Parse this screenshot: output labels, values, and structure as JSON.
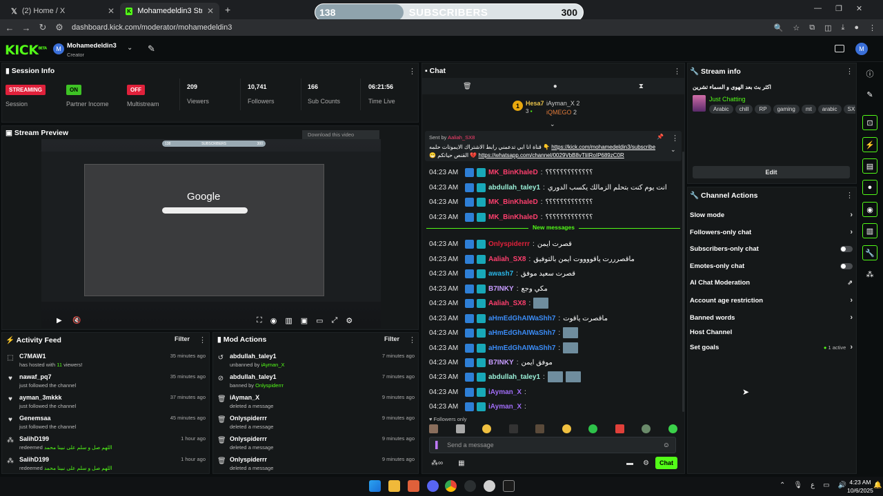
{
  "browser": {
    "tabs": [
      {
        "title": "(2) Home / X"
      },
      {
        "title": "Mohamedeldin3 Stream - Kick"
      }
    ],
    "url": "dashboard.kick.com/moderator/mohamedeldin3"
  },
  "overlay": {
    "left": "138",
    "label": "SUBSCRIBERS",
    "right": "300",
    "progress": 0.33
  },
  "header": {
    "logo": "KICK",
    "channel": "Mohamedeldin3",
    "role": "Creator",
    "avatar": "M"
  },
  "session": {
    "title": "Session Info",
    "items": [
      {
        "badge": "STREAMING",
        "label": "Session",
        "color": "#e0213b"
      },
      {
        "badge": "ON",
        "label": "Partner Income",
        "color": "#3ec325"
      },
      {
        "badge": "OFF",
        "label": "Multistream",
        "color": "#e0213b"
      }
    ],
    "stats": [
      {
        "value": "209",
        "label": "Viewers"
      },
      {
        "value": "10,741",
        "label": "Followers"
      },
      {
        "value": "166",
        "label": "Sub Counts"
      },
      {
        "value": "06:21:56",
        "label": "Time Live"
      }
    ]
  },
  "preview": {
    "title": "Stream Preview",
    "download": "Download this video",
    "inner_label": "SUBSCRIBERS",
    "inner_left": "138",
    "inner_right": "300",
    "google": "Google"
  },
  "activity": {
    "title": "Activity Feed",
    "filter": "Filter",
    "items": [
      {
        "name": "C7MAW1",
        "desc_pre": "has hosted with ",
        "desc_hl": "11",
        "desc_post": " viewers!",
        "time": "35 minutes ago",
        "icon": "host-icon"
      },
      {
        "name": "nawaf_pq7",
        "desc_pre": "just followed the channel",
        "desc_hl": "",
        "desc_post": "",
        "time": "35 minutes ago",
        "icon": "heart-icon"
      },
      {
        "name": "ayman_3mkkk",
        "desc_pre": "just followed the channel",
        "desc_hl": "",
        "desc_post": "",
        "time": "37 minutes ago",
        "icon": "heart-icon"
      },
      {
        "name": "Genemsaa",
        "desc_pre": "just followed the channel",
        "desc_hl": "",
        "desc_post": "",
        "time": "45 minutes ago",
        "icon": "heart-icon"
      },
      {
        "name": "SalihD199",
        "desc_pre": "redeemed ",
        "desc_hl": "اللهم صل و سلم على نبينا محمد",
        "desc_post": "",
        "time": "1 hour ago",
        "icon": "points-icon"
      },
      {
        "name": "SalihD199",
        "desc_pre": "redeemed ",
        "desc_hl": "اللهم صل و سلم على نبينا محمد",
        "desc_post": "",
        "time": "1 hour ago",
        "icon": "points-icon"
      }
    ]
  },
  "mod": {
    "title": "Mod Actions",
    "filter": "Filter",
    "items": [
      {
        "name": "abdullah_taley1",
        "desc_pre": "unbanned by ",
        "desc_hl": "iAyman_X",
        "time": "7 minutes ago",
        "icon": "unban-icon"
      },
      {
        "name": "abdullah_taley1",
        "desc_pre": "banned by ",
        "desc_hl": "Onlyspiderrr",
        "time": "7 minutes ago",
        "icon": "ban-icon"
      },
      {
        "name": "iAyman_X",
        "desc_pre": "deleted a message",
        "desc_hl": "",
        "time": "9 minutes ago",
        "icon": "trash-icon"
      },
      {
        "name": "Onlyspiderrr",
        "desc_pre": "deleted a message",
        "desc_hl": "",
        "time": "9 minutes ago",
        "icon": "trash-icon"
      },
      {
        "name": "Onlyspiderrr",
        "desc_pre": "deleted a message",
        "desc_hl": "",
        "time": "9 minutes ago",
        "icon": "trash-icon"
      },
      {
        "name": "Onlyspiderrr",
        "desc_pre": "deleted a message",
        "desc_hl": "",
        "time": "9 minutes ago",
        "icon": "trash-icon"
      }
    ]
  },
  "chat": {
    "title": "Chat",
    "leaders": [
      {
        "name": "Hesa7",
        "count": "3"
      },
      {
        "name": "iAyman_X",
        "count": "2"
      },
      {
        "name": "iQMEGO",
        "count": "2"
      }
    ],
    "leader_rank": "1",
    "pinned": {
      "sent_by": "Sent by",
      "user": "Aaliah_SX8",
      "line1_text": "قناة انا ابي تدعمني رابط الاشتراك الايموتات حلمه 👇",
      "line1_link": "https://kick.com/mohamedeldin3/subscribe",
      "line2_link": "https://whatsapp.com/channel/0029VbB8vTliIRoIP689zC0R",
      "line2_text": "😁 القنص حياتكم 💔"
    },
    "new_label": "New messages",
    "messages": [
      {
        "time": "04:23 AM",
        "user": "MK_BinKhaleD",
        "color": "#ff3f6e",
        "text": "؟؟؟؟؟؟؟؟؟؟؟؟؟",
        "img": 0
      },
      {
        "time": "04:23 AM",
        "user": "abdullah_taley1",
        "color": "#9af0d8",
        "text": "انت يوم كنت بتحلم الزمالك يكسب الدوري",
        "img": 0
      },
      {
        "time": "04:23 AM",
        "user": "MK_BinKhaleD",
        "color": "#ff3f6e",
        "text": "؟؟؟؟؟؟؟؟؟؟؟؟؟",
        "img": 0
      },
      {
        "time": "04:23 AM",
        "user": "MK_BinKhaleD",
        "color": "#ff3f6e",
        "text": "؟؟؟؟؟؟؟؟؟؟؟؟؟",
        "img": 0
      },
      {
        "time": "04:23 AM",
        "user": "Onlyspiderrr",
        "color": "#e0213b",
        "text": "قصرت ايمن",
        "img": 0
      },
      {
        "time": "04:23 AM",
        "user": "Aaliah_SX8",
        "color": "#ff3f6e",
        "text": "ماقصرررت ياقووووت ايمن بالتوفيق",
        "img": 0
      },
      {
        "time": "04:23 AM",
        "user": "awash7",
        "color": "#2ab6e8",
        "text": "قصرت سعيد موفق",
        "img": 0
      },
      {
        "time": "04:23 AM",
        "user": "B7INKY",
        "color": "#c79cff",
        "text": "مكي وجع",
        "img": 0
      },
      {
        "time": "04:23 AM",
        "user": "Aaliah_SX8",
        "color": "#ff3f6e",
        "text": "",
        "img": 1
      },
      {
        "time": "04:23 AM",
        "user": "aHmEdGhAIWaShh7",
        "color": "#3b8cf7",
        "text": "ماقصرت ياقوت",
        "img": 0
      },
      {
        "time": "04:23 AM",
        "user": "aHmEdGhAIWaShh7",
        "color": "#3b8cf7",
        "text": "",
        "img": 1
      },
      {
        "time": "04:23 AM",
        "user": "aHmEdGhAIWaShh7",
        "color": "#3b8cf7",
        "text": "",
        "img": 1
      },
      {
        "time": "04:23 AM",
        "user": "B7INKY",
        "color": "#c79cff",
        "text": "موفق ايمن",
        "img": 0
      },
      {
        "time": "04:23 AM",
        "user": "abdullah_taley1",
        "color": "#9af0d8",
        "text": "",
        "img": 2
      },
      {
        "time": "04:23 AM",
        "user": "iAyman_X",
        "color": "#a06cf7",
        "text": "",
        "img": 0
      },
      {
        "time": "04:23 AM",
        "user": "iAyman_X",
        "color": "#a06cf7",
        "text": "",
        "img": 0
      }
    ],
    "followers_only": "Followers only",
    "placeholder": "Send a message",
    "send": "Chat"
  },
  "stream_info": {
    "title": "Stream info",
    "stream_title": "اكثر بث بعد الهوى و السماء تشرين",
    "category": "Just Chatting",
    "tags": [
      "Arabic",
      "chill",
      "RP",
      "gaming",
      "mt",
      "arabic",
      "SXB"
    ],
    "edit": "Edit"
  },
  "channel_actions": {
    "title": "Channel Actions",
    "items": [
      {
        "label": "Slow mode",
        "kind": "chevron"
      },
      {
        "label": "Followers-only chat",
        "kind": "chevron"
      },
      {
        "label": "Subscribers-only chat",
        "kind": "toggle"
      },
      {
        "label": "Emotes-only chat",
        "kind": "toggle"
      },
      {
        "label": "AI Chat Moderation",
        "kind": "external"
      },
      {
        "label": "Account age restriction",
        "kind": "chevron"
      },
      {
        "label": "Banned words",
        "kind": "chevron"
      },
      {
        "label": "Host Channel",
        "kind": "none"
      },
      {
        "label": "Set goals",
        "kind": "goal",
        "extra": "1 active"
      }
    ]
  },
  "taskbar": {
    "time": "4:23 AM",
    "date": "10/6/2025",
    "lang": "ع"
  }
}
